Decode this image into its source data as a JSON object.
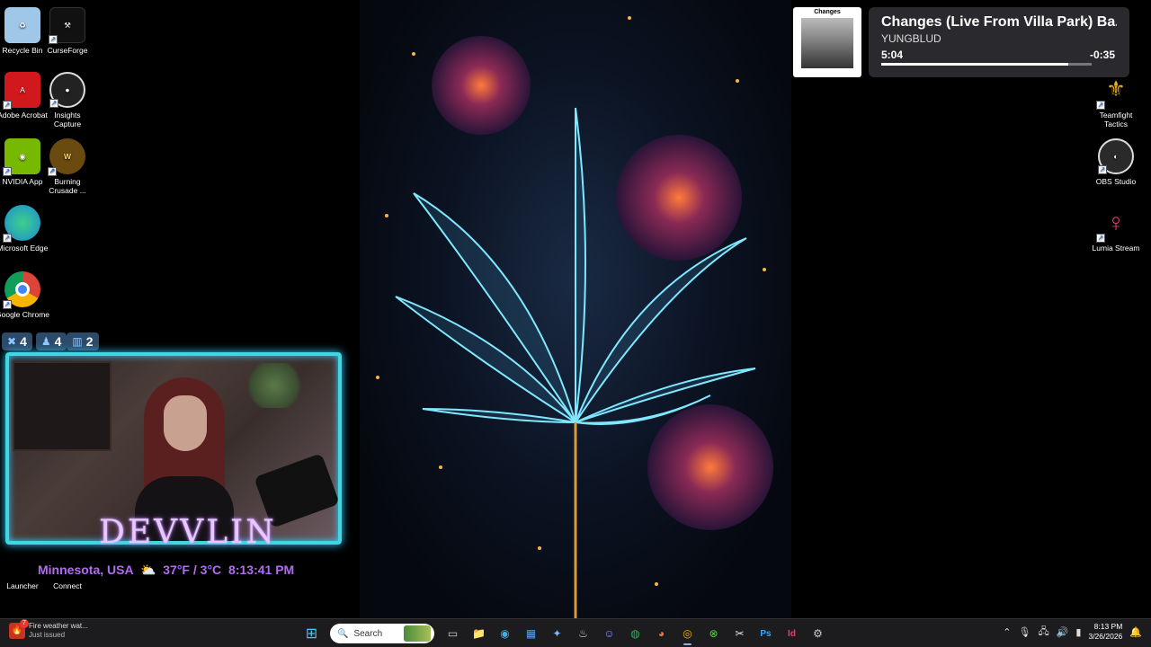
{
  "desktop_icons_left": [
    {
      "label": "Recycle Bin",
      "icon": "recycle-bin-icon",
      "color": "#9fc7e8"
    },
    {
      "label": "CurseForge",
      "icon": "curseforge-anvil-icon",
      "color": "#111111"
    },
    {
      "label": "Adobe Acrobat",
      "icon": "acrobat-icon",
      "color": "#d0181d"
    },
    {
      "label": "Insights Capture",
      "icon": "insights-capture-icon",
      "color": "#222222"
    },
    {
      "label": "NVIDIA App",
      "icon": "nvidia-icon",
      "color": "#76b900"
    },
    {
      "label": "Burning Crusade ...",
      "icon": "wow-icon",
      "color": "#6b4a10"
    },
    {
      "label": "Microsoft Edge",
      "icon": "edge-icon",
      "color": "#1a8ad4"
    },
    {
      "label": "Google Chrome",
      "icon": "chrome-icon",
      "color": "#e8e8e8"
    }
  ],
  "desktop_icons_right": [
    {
      "label": "Teamfight Tactics",
      "icon": "teamfight-tactics-icon",
      "color": "#e8b020"
    },
    {
      "label": "OBS Studio",
      "icon": "obs-icon",
      "color": "#2a2a2a"
    },
    {
      "label": "Lumia Stream",
      "icon": "lumia-stream-icon",
      "color": "#e0406a"
    }
  ],
  "desktop_icons_bottom": [
    {
      "label": "Launcher",
      "icon": "launcher-icon"
    },
    {
      "label": "Connect",
      "icon": "connect-icon"
    }
  ],
  "media": {
    "album_art_title": "Changes",
    "title": "Changes (Live From Villa Park) Ba...",
    "artist": "YUNGBLUD",
    "elapsed": "5:04",
    "remaining": "-0:35",
    "progress": 0.89
  },
  "stats": [
    {
      "icon": "kills-icon",
      "value": "4"
    },
    {
      "icon": "followers-icon",
      "value": "4"
    },
    {
      "icon": "viewers-icon",
      "value": "2"
    }
  ],
  "overlay": {
    "brand": "DEVVLIN",
    "location": "Minnesota, USA",
    "weather_icon": "partly-cloudy-icon",
    "temperature": "37°F / 3°C",
    "time": "8:13:41 PM"
  },
  "taskbar": {
    "notification": {
      "badge": "7",
      "title": "Fire weather wat...",
      "subtitle": "Just issued"
    },
    "search_placeholder": "Search",
    "clock_time": "8:13 PM",
    "clock_date": "3/26/2026"
  }
}
